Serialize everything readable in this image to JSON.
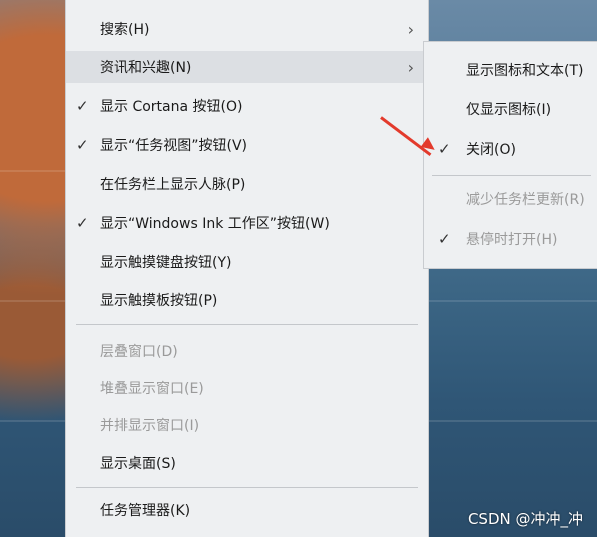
{
  "context_menu": {
    "items": [
      {
        "label": "搜索(H)",
        "checked": false,
        "disabled": false,
        "submenu": true
      },
      {
        "label": "资讯和兴趣(N)",
        "checked": false,
        "disabled": false,
        "submenu": true,
        "hover": true
      },
      {
        "label": "显示 Cortana 按钮(O)",
        "checked": true,
        "disabled": false
      },
      {
        "label": "显示“任务视图”按钮(V)",
        "checked": true,
        "disabled": false
      },
      {
        "label": "在任务栏上显示人脉(P)",
        "checked": false,
        "disabled": false
      },
      {
        "label": "显示“Windows Ink 工作区”按钮(W)",
        "checked": true,
        "disabled": false
      },
      {
        "label": "显示触摸键盘按钮(Y)",
        "checked": false,
        "disabled": false
      },
      {
        "label": "显示触摸板按钮(P)",
        "checked": false,
        "disabled": false
      },
      {
        "label": "层叠窗口(D)",
        "checked": false,
        "disabled": true
      },
      {
        "label": "堆叠显示窗口(E)",
        "checked": false,
        "disabled": true
      },
      {
        "label": "并排显示窗口(I)",
        "checked": false,
        "disabled": true
      },
      {
        "label": "显示桌面(S)",
        "checked": false,
        "disabled": false
      },
      {
        "label": "任务管理器(K)",
        "checked": false,
        "disabled": false
      }
    ]
  },
  "news_submenu": {
    "items": [
      {
        "label": "显示图标和文本(T)",
        "checked": false,
        "disabled": false
      },
      {
        "label": "仅显示图标(I)",
        "checked": false,
        "disabled": false
      },
      {
        "label": "关闭(O)",
        "checked": true,
        "disabled": false
      },
      {
        "label": "减少任务栏更新(R)",
        "checked": false,
        "disabled": true
      },
      {
        "label": "悬停时打开(H)",
        "checked": true,
        "disabled": true
      }
    ]
  },
  "glyphs": {
    "check": "✓",
    "chevron": "›"
  },
  "colors": {
    "annotation_arrow": "#e33a2c",
    "menu_bg": "#eef0f2"
  },
  "watermark": "CSDN @冲冲_冲"
}
